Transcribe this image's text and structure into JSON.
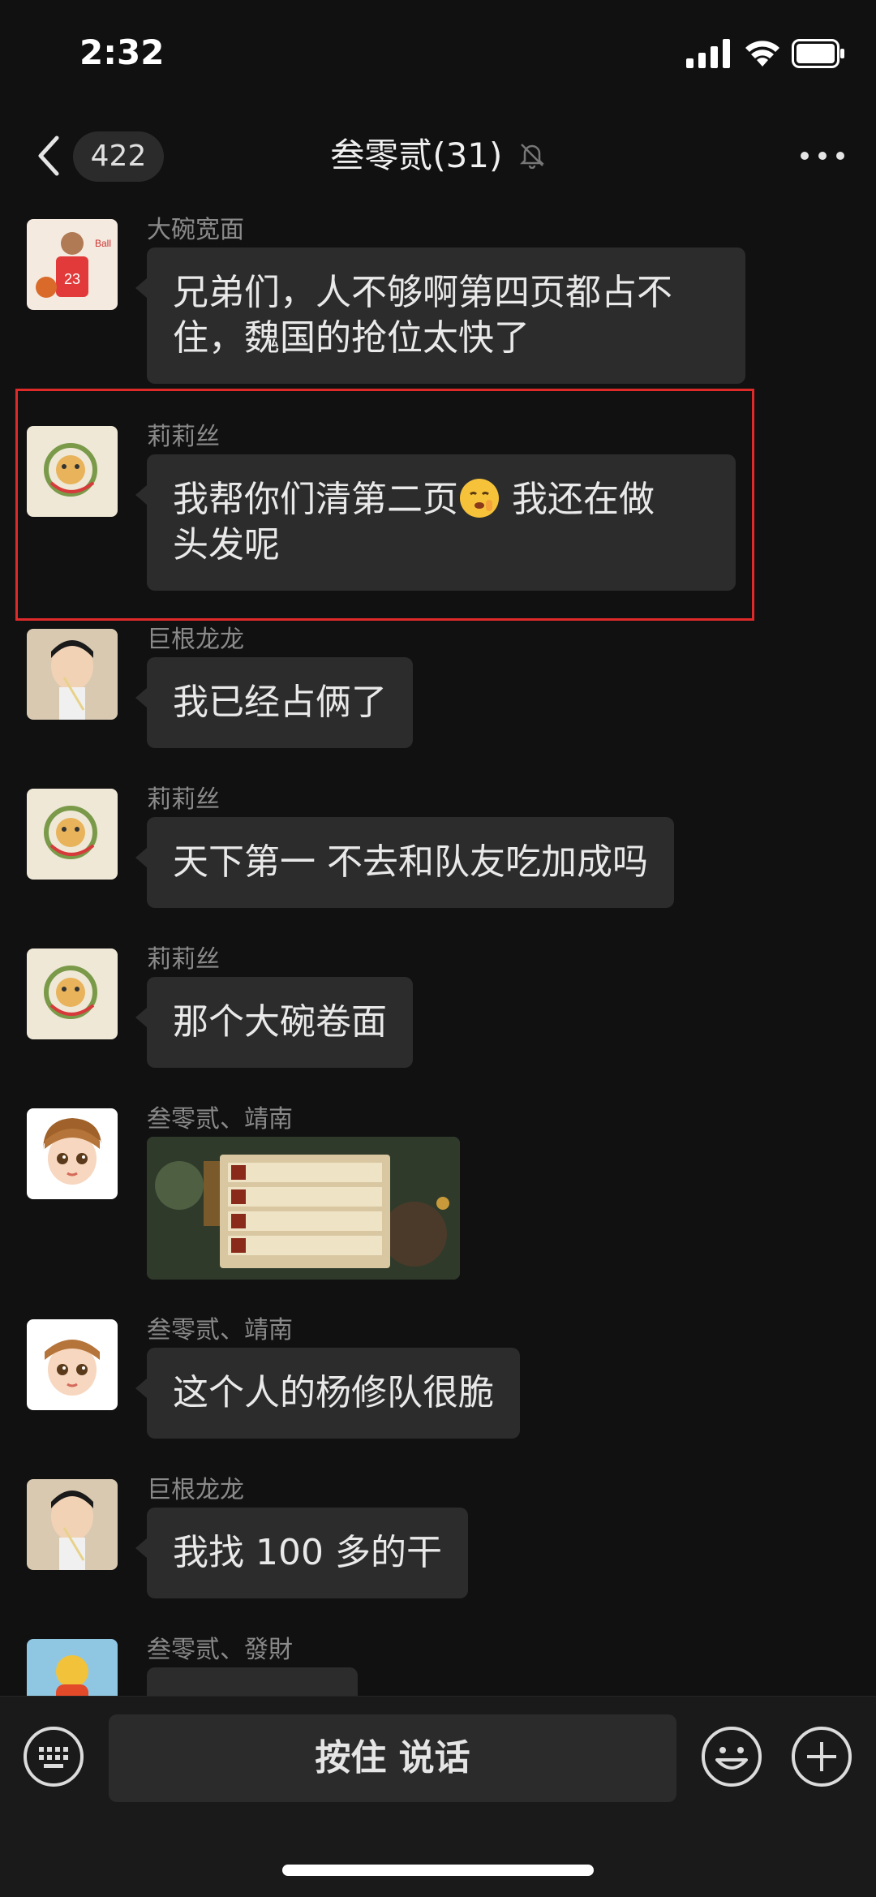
{
  "status_bar": {
    "time": "2:32"
  },
  "nav": {
    "unread_count": "422",
    "title": "叁零贰(31)"
  },
  "messages": [
    {
      "sender": "大碗宽面",
      "text_line1": "兄弟们，人不够啊第四页都占不",
      "text_line2": "住，魏国的抢位太快了"
    },
    {
      "sender": "莉莉丝",
      "text_line1_a": "我帮你们清第二页",
      "text_line1_b": " 我还在做",
      "text_line2": "头发呢"
    },
    {
      "sender": "巨根龙龙",
      "text": "我已经占俩了"
    },
    {
      "sender": "莉莉丝",
      "text": "天下第一 不去和队友吃加成吗"
    },
    {
      "sender": "莉莉丝",
      "text": "那个大碗卷面"
    },
    {
      "sender": "叁零贰、靖南",
      "type": "image"
    },
    {
      "sender": "叁零贰、靖南",
      "text": "这个人的杨修队很脆"
    },
    {
      "sender": "巨根龙龙",
      "text": "我找 100 多的干"
    },
    {
      "sender": "叁零贰、發財",
      "text": ""
    }
  ],
  "input_bar": {
    "talk_label": "按住 说话"
  },
  "colors": {
    "background": "#111111",
    "bubble": "#2c2c2c",
    "highlight": "#e02a2a"
  }
}
